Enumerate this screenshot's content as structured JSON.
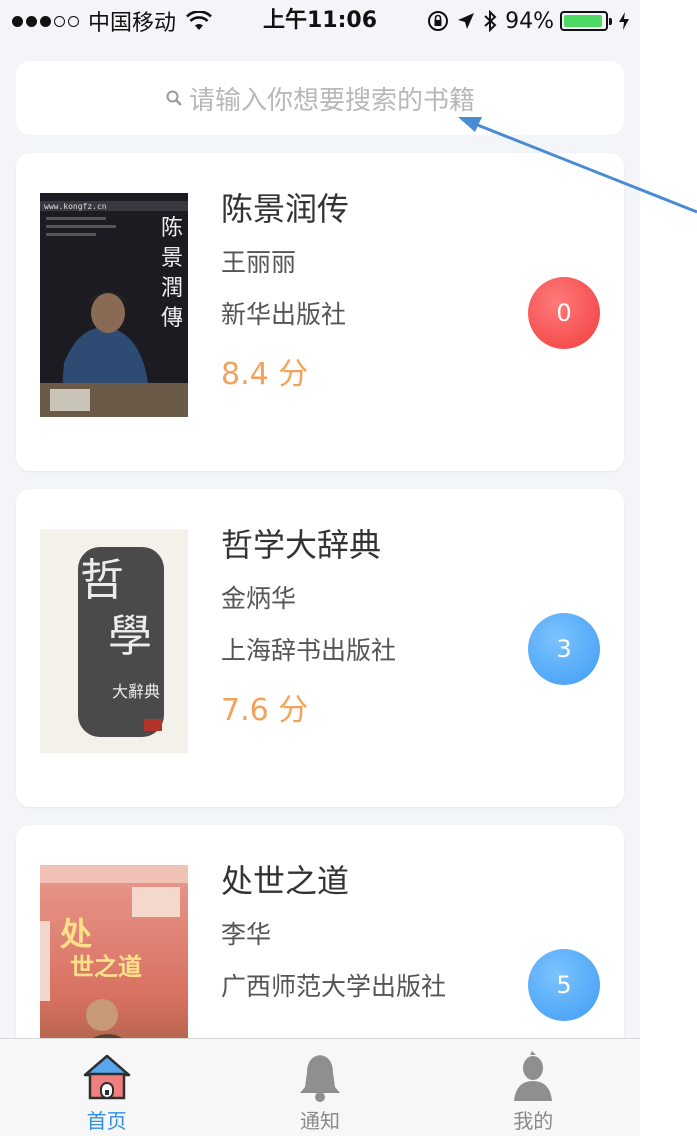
{
  "status_bar": {
    "carrier": "中国移动",
    "time": "上午11:06",
    "battery_percent": "94%",
    "battery_level": 0.94,
    "signal_bars": 3
  },
  "search": {
    "placeholder": "请输入你想要搜索的书籍"
  },
  "books": [
    {
      "title": "陈景润传",
      "author": "王丽丽",
      "publisher": "新华出版社",
      "rating": "8.4 分",
      "count": "0",
      "badge_color": "#f23d3d",
      "cover_lines": [
        "陈",
        "景",
        "潤",
        "傳"
      ],
      "cover_top_text": "www.kongfz.cn"
    },
    {
      "title": "哲学大辞典",
      "author": "金炳华",
      "publisher": "上海辞书出版社",
      "rating": "7.6 分",
      "count": "3",
      "badge_color": "#3f9cf3",
      "cover_lines": [
        "哲",
        "學",
        "大辭典"
      ]
    },
    {
      "title": "处世之道",
      "author": "李华",
      "publisher": "广西师范大学出版社",
      "rating": "",
      "count": "5",
      "badge_color": "#3f9cf3",
      "cover_lines": [
        "处",
        "世之道"
      ]
    }
  ],
  "tabs": [
    {
      "label": "首页",
      "icon": "home-icon",
      "active": true
    },
    {
      "label": "通知",
      "icon": "bell-icon",
      "active": false
    },
    {
      "label": "我的",
      "icon": "user-icon",
      "active": false
    }
  ],
  "colors": {
    "accent": "#2f8fe6",
    "rating": "#f3a25b",
    "background": "#f3f5f9",
    "annotation_arrow": "#4a8bd6"
  }
}
